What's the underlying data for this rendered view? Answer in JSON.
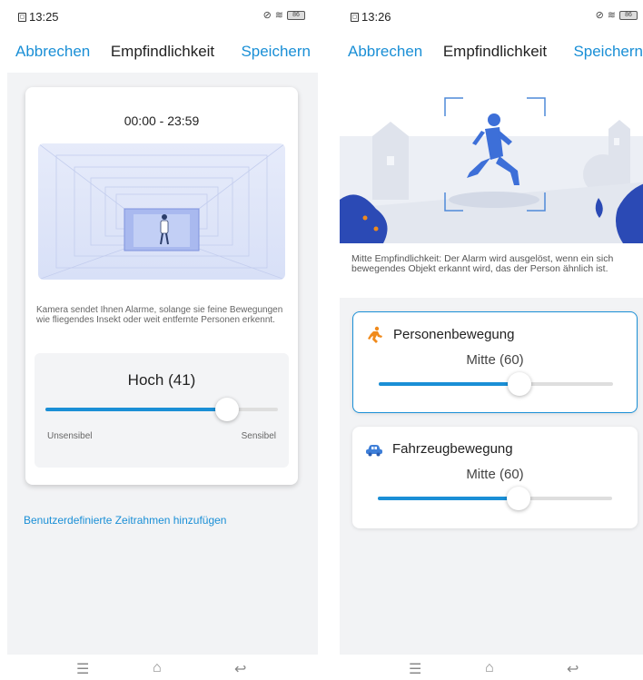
{
  "left": {
    "status": {
      "time": "13:25",
      "battery": "86"
    },
    "nav": {
      "cancel": "Abbrechen",
      "title": "Empfindlichkeit",
      "save": "Speichern"
    },
    "card": {
      "time_range": "00:00 - 23:59",
      "description": "Kamera sendet Ihnen Alarme, solange sie feine Bewegungen wie fliegendes Insekt oder weit entfernte Personen erkennt.",
      "level_label": "Hoch (41)",
      "slider_value_pct": 41,
      "min_label": "Unsensibel",
      "max_label": "Sensibel"
    },
    "add_link": "Benutzerdefinierte Zeitrahmen hinzufügen"
  },
  "right": {
    "status": {
      "time": "13:26",
      "battery": "86"
    },
    "nav": {
      "cancel": "Abbrechen",
      "title": "Empfindlichkeit",
      "save": "Speichern"
    },
    "mode_description": "Mitte Empfindlichkeit: Der Alarm wird ausgelöst, wenn ein sich bewegendes Objekt erkannt wird, das der Person ähnlich ist.",
    "person": {
      "title": "Personenbewegung",
      "value_label": "Mitte (60)",
      "slider_value_pct": 60,
      "icon": "running-person-icon"
    },
    "vehicle": {
      "title": "Fahrzeugbewegung",
      "value_label": "Mitte (60)",
      "slider_value_pct": 60,
      "icon": "car-icon"
    }
  },
  "colors": {
    "accent": "#1a8fd6",
    "person_icon": "#f08a1c",
    "vehicle_icon": "#3d7ed8"
  }
}
